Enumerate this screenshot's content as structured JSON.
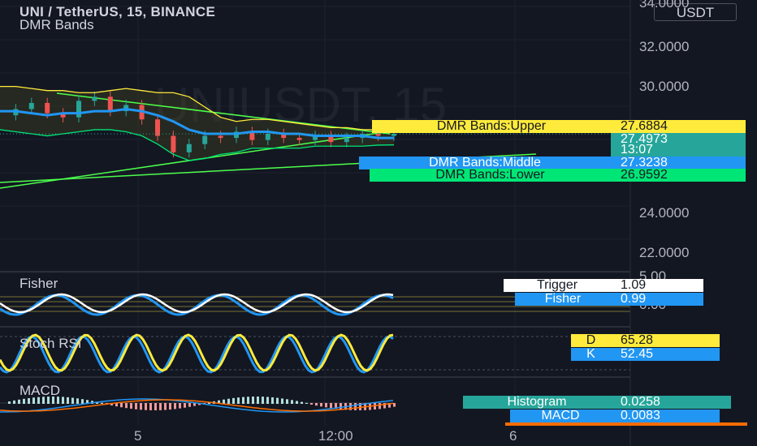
{
  "header": {
    "symbol_line": "UNI / TetherUS, 15, BINANCE",
    "indicator": "DMR Bands"
  },
  "currency_button": "USDT",
  "watermark": "UNIUSDT, 15",
  "price_axis": [
    "34.0000",
    "32.0000",
    "30.0000",
    "24.0000",
    "22.0000"
  ],
  "time_axis": [
    "5",
    "12:00",
    "6"
  ],
  "indicator_axis": [
    "5.00",
    "0.00"
  ],
  "dmr_labels": [
    {
      "name": "DMR Bands:Upper",
      "value": "27.6884",
      "color": "#ffeb3b",
      "text": "#131722"
    },
    {
      "name": "",
      "value": "27.4973",
      "color": "#26a69a",
      "text": "#ffffff"
    },
    {
      "name": "",
      "value": "13:07",
      "color": "#26a69a",
      "text": "#ffffff"
    },
    {
      "name": "DMR Bands:Middle",
      "value": "27.3238",
      "color": "#2196f3",
      "text": "#ffffff"
    },
    {
      "name": "DMR Bands:Lower",
      "value": "26.9592",
      "color": "#00e676",
      "text": "#131722"
    }
  ],
  "panes": {
    "fisher": {
      "title": "Fisher",
      "labels": [
        {
          "name": "Trigger",
          "value": "1.09",
          "color": "#ffffff",
          "text": "#131722"
        },
        {
          "name": "Fisher",
          "value": "0.99",
          "color": "#2196f3",
          "text": "#ffffff"
        }
      ]
    },
    "stoch": {
      "title": "Stoch RSI",
      "labels": [
        {
          "name": "D",
          "value": "65.28",
          "color": "#ffeb3b",
          "text": "#131722"
        },
        {
          "name": "K",
          "value": "52.45",
          "color": "#2196f3",
          "text": "#ffffff"
        }
      ]
    },
    "macd": {
      "title": "MACD",
      "labels": [
        {
          "name": "Histogram",
          "value": "0.0258",
          "color": "#26a69a",
          "text": "#ffffff"
        },
        {
          "name": "MACD",
          "value": "0.0083",
          "color": "#2196f3",
          "text": "#ffffff"
        }
      ]
    }
  },
  "chart_data": {
    "type": "line",
    "title": "UNI / TetherUS, 15, BINANCE",
    "ylim": [
      21,
      34
    ],
    "ylabel": "USDT",
    "x_ticks": [
      "5",
      "12:00",
      "6"
    ],
    "series": [
      {
        "name": "DMR Bands:Upper",
        "color": "#ffeb3b",
        "values": [
          29.8,
          29.8,
          29.7,
          29.6,
          29.6,
          29.5,
          29.5,
          29.6,
          29.7,
          29.6,
          29.5,
          29.5,
          29.3,
          28.8,
          28.3,
          28.1,
          28.2,
          28.2,
          28.1,
          28.0,
          27.9,
          27.8,
          27.8,
          27.7,
          27.7,
          27.7
        ]
      },
      {
        "name": "DMR Bands:Middle",
        "color": "#2196f3",
        "values": [
          28.6,
          28.6,
          28.5,
          28.4,
          28.5,
          28.5,
          28.6,
          28.6,
          28.7,
          28.6,
          28.4,
          28.1,
          27.7,
          27.5,
          27.5,
          27.5,
          27.6,
          27.6,
          27.5,
          27.5,
          27.4,
          27.4,
          27.4,
          27.4,
          27.3,
          27.3
        ]
      },
      {
        "name": "DMR Bands:Lower",
        "color": "#00e676",
        "values": [
          27.7,
          27.6,
          27.5,
          27.4,
          27.5,
          27.6,
          27.7,
          27.7,
          27.6,
          27.4,
          27.0,
          26.5,
          26.2,
          26.3,
          26.5,
          26.6,
          26.8,
          26.8,
          26.8,
          26.8,
          26.9,
          26.9,
          26.9,
          26.9,
          26.95,
          26.96
        ]
      },
      {
        "name": "",
        "color": "#26a69a",
        "values": [
          28.4,
          28.7,
          29.0,
          28.5,
          28.3,
          29.1,
          29.3,
          28.6,
          28.9,
          28.2,
          27.4,
          26.6,
          27.0,
          27.4,
          27.3,
          27.6,
          27.2,
          27.5,
          27.3,
          27.2,
          27.4,
          27.1,
          27.3,
          27.5,
          27.4,
          27.5
        ]
      }
    ],
    "current_price": 27.4973
  }
}
